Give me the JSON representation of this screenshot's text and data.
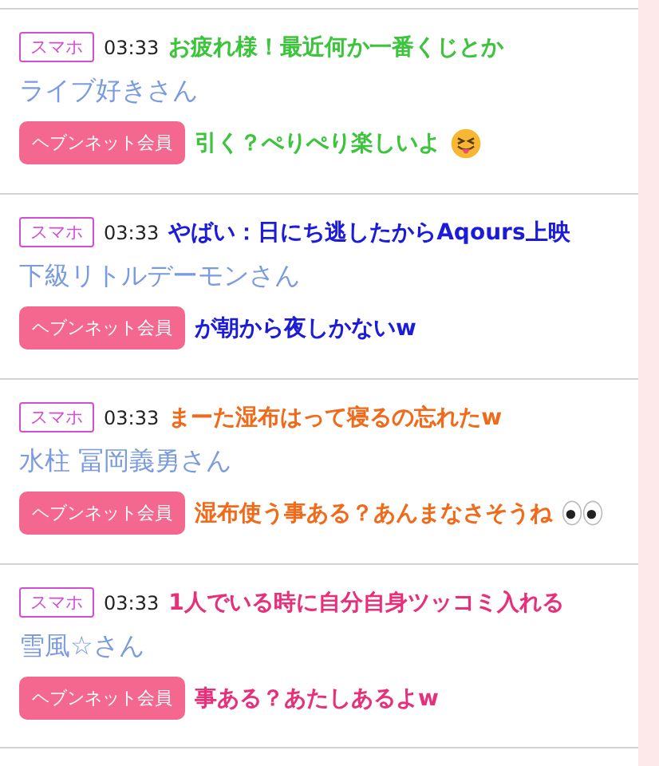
{
  "posts": [
    {
      "badge": "スマホ",
      "time": "03:33",
      "name": "ライブ好きさん",
      "member_button": "ヘブンネット会員",
      "comment": {
        "color": "#3cc43c",
        "lines": [
          "お疲れ様！最近何か一番くじとか",
          "引く？ぺりぺり楽しいよ"
        ]
      }
    },
    {
      "badge": "スマホ",
      "time": "03:33",
      "name": "下級リトルデーモンさん",
      "member_button": "ヘブンネット会員",
      "comment": {
        "color": "#1c1cd8",
        "lines": [
          "やばい：日にち逃したからAqours上映",
          "が朝から夜しかないw"
        ]
      }
    },
    {
      "badge": "スマホ",
      "time": "03:33",
      "name": "水柱 冨岡義勇さん",
      "member_button": "ヘブンネット会員",
      "comment": {
        "color": "#f06a1a",
        "lines": [
          "まーた湿布はって寝るの忘れたw",
          "湿布使う事ある？あんまなさそうね"
        ]
      }
    },
    {
      "badge": "スマホ",
      "time": "03:33",
      "name": "雪風☆さん",
      "member_button": "ヘブンネット会員",
      "comment": {
        "color": "#e8307a",
        "lines": [
          "1人でいる時に自分自身ツッコミ入れる",
          "事ある？あたしあるよw"
        ]
      }
    }
  ]
}
